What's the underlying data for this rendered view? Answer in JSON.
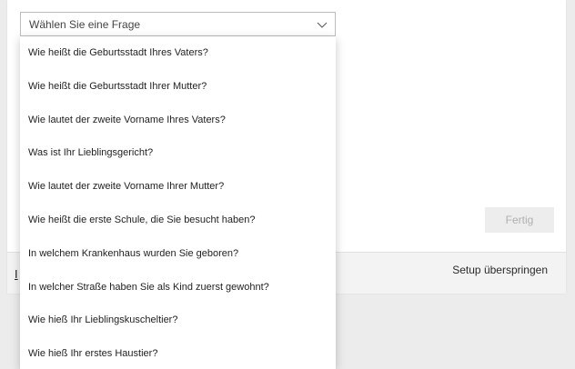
{
  "question_select": {
    "placeholder": "Wählen Sie eine Frage",
    "options": [
      "Wie heißt die Geburtsstadt Ihres Vaters?",
      "Wie heißt die Geburtsstadt Ihrer Mutter?",
      "Wie lautet der zweite Vorname Ihres Vaters?",
      "Was ist Ihr Lieblingsgericht?",
      "Wie lautet der zweite Vorname Ihrer Mutter?",
      "Wie heißt die erste Schule, die Sie besucht haben?",
      "In welchem Krankenhaus wurden Sie geboren?",
      "In welcher Straße haben Sie als Kind zuerst gewohnt?",
      "Wie hieß Ihr Lieblingskuscheltier?",
      "Wie hieß Ihr erstes Haustier?"
    ]
  },
  "actions": {
    "done_label": "Fertig",
    "skip_label": "Setup überspringen",
    "footer_link_label": "I"
  },
  "icons": {
    "dropdown": "chevron-down-icon"
  },
  "colors": {
    "page_background": "#ececec",
    "card_background": "#ffffff",
    "footer_background": "#f3f3f3",
    "disabled_button_background": "#ededed",
    "disabled_button_text": "#b0b0b0"
  }
}
